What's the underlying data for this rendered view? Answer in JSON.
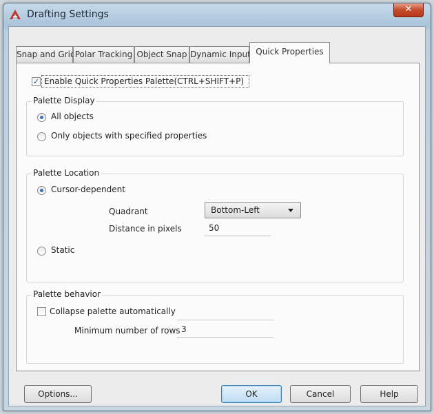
{
  "window": {
    "title": "Drafting Settings",
    "close_glyph": "✕"
  },
  "tabs": [
    {
      "label": "Snap and Grid",
      "active": false
    },
    {
      "label": "Polar Tracking",
      "active": false
    },
    {
      "label": "Object Snap",
      "active": false
    },
    {
      "label": "Dynamic Input",
      "active": false
    },
    {
      "label": "Quick Properties",
      "active": true
    }
  ],
  "enable_palette": {
    "label": "Enable Quick Properties Palette(CTRL+SHIFT+P)",
    "checked": true
  },
  "palette_display": {
    "title": "Palette Display",
    "options": [
      {
        "label": "All objects",
        "selected": true
      },
      {
        "label": "Only objects with specified properties",
        "selected": false
      }
    ]
  },
  "palette_location": {
    "title": "Palette Location",
    "cursor_dependent": {
      "label": "Cursor-dependent",
      "selected": true
    },
    "quadrant_label": "Quadrant",
    "quadrant_value": "Bottom-Left",
    "distance_label": "Distance in pixels",
    "distance_value": "50",
    "static": {
      "label": "Static",
      "selected": false
    }
  },
  "palette_behavior": {
    "title": "Palette behavior",
    "collapse": {
      "label": "Collapse palette automatically",
      "checked": false
    },
    "min_rows_label": "Minimum number of rows",
    "min_rows_value": "3"
  },
  "buttons": {
    "options": "Options...",
    "ok": "OK",
    "cancel": "Cancel",
    "help": "Help"
  },
  "icons": {
    "app": "autocad-app-icon",
    "close": "close-icon",
    "dropdown": "chevron-down-icon"
  }
}
